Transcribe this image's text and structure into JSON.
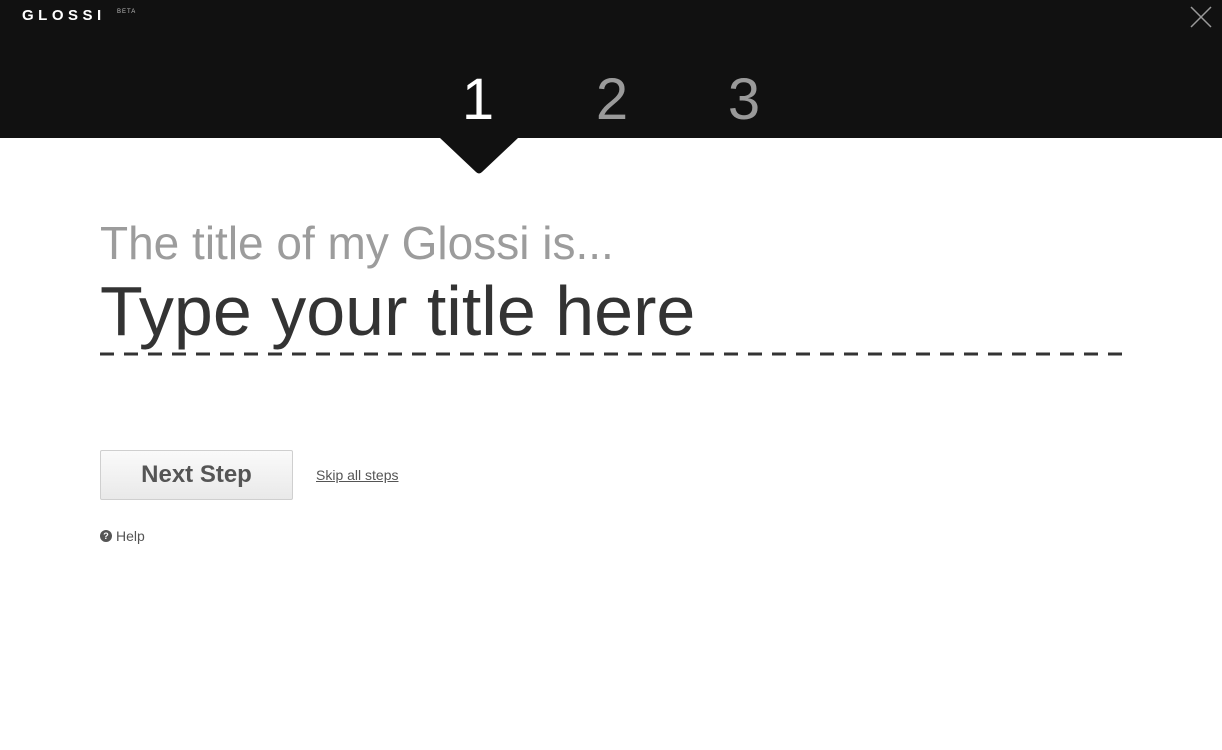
{
  "header": {
    "brand": "GLOSSI",
    "beta_badge": "BETA",
    "close_icon": "close-icon"
  },
  "steps": [
    {
      "label": "1",
      "state": "active"
    },
    {
      "label": "2",
      "state": "inactive"
    },
    {
      "label": "3",
      "state": "inactive"
    }
  ],
  "form": {
    "prompt": "The title of my Glossi is...",
    "title_placeholder": "Type your title here",
    "title_value": ""
  },
  "actions": {
    "next_step_label": "Next Step",
    "skip_label": "Skip all steps",
    "help_label": "Help",
    "help_icon_glyph": "?",
    "help_icon": "question-circle-icon"
  },
  "colors": {
    "header_bg": "#111111",
    "active_step": "#ffffff",
    "inactive_step": "#9a9a9a",
    "prompt_text": "#9c9c9c",
    "title_text": "#333333"
  }
}
